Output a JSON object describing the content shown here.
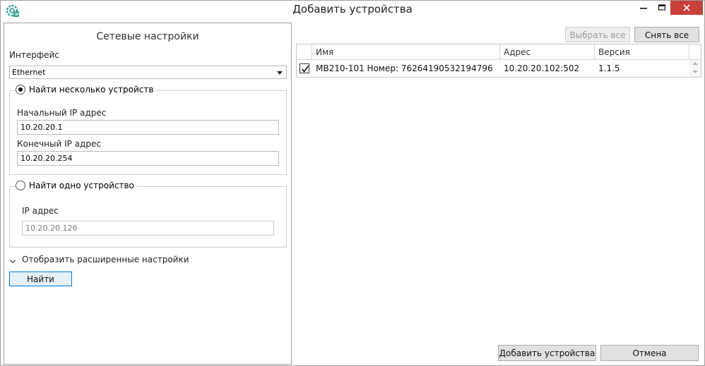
{
  "window": {
    "title": "Добавить устройства",
    "close_color": "#c8403a",
    "icons": {
      "app": "gear-app-icon",
      "minimize": "minimize-icon",
      "maximize": "maximize-icon",
      "close": "close-icon"
    }
  },
  "left": {
    "title": "Сетевые настройки",
    "interface_label": "Интерфейс",
    "interface_value": "Ethernet",
    "multi": {
      "label": "Найти несколько устройств",
      "selected": true,
      "start_ip_label": "Начальный IP адрес",
      "start_ip": "10.20.20.1",
      "end_ip_label": "Конечный IP адрес",
      "end_ip": "10.20.20.254"
    },
    "single": {
      "label": "Найти одно устройство",
      "selected": false,
      "ip_label": "IP адрес",
      "ip": "10.20.20.126"
    },
    "advanced_label": "Отобразить расширенные настройки",
    "find_button": "Найти"
  },
  "right": {
    "select_all": "Выбрать все",
    "deselect_all": "Снять все",
    "columns": [
      "Имя",
      "Адрес",
      "Версия"
    ],
    "rows": [
      {
        "checked": true,
        "name": "МВ210-101 Номер: 76264190532194796",
        "address": "10.20.20.102:502",
        "version": "1.1.5"
      }
    ],
    "add_button": "Добавить устройства",
    "cancel_button": "Отмена"
  }
}
